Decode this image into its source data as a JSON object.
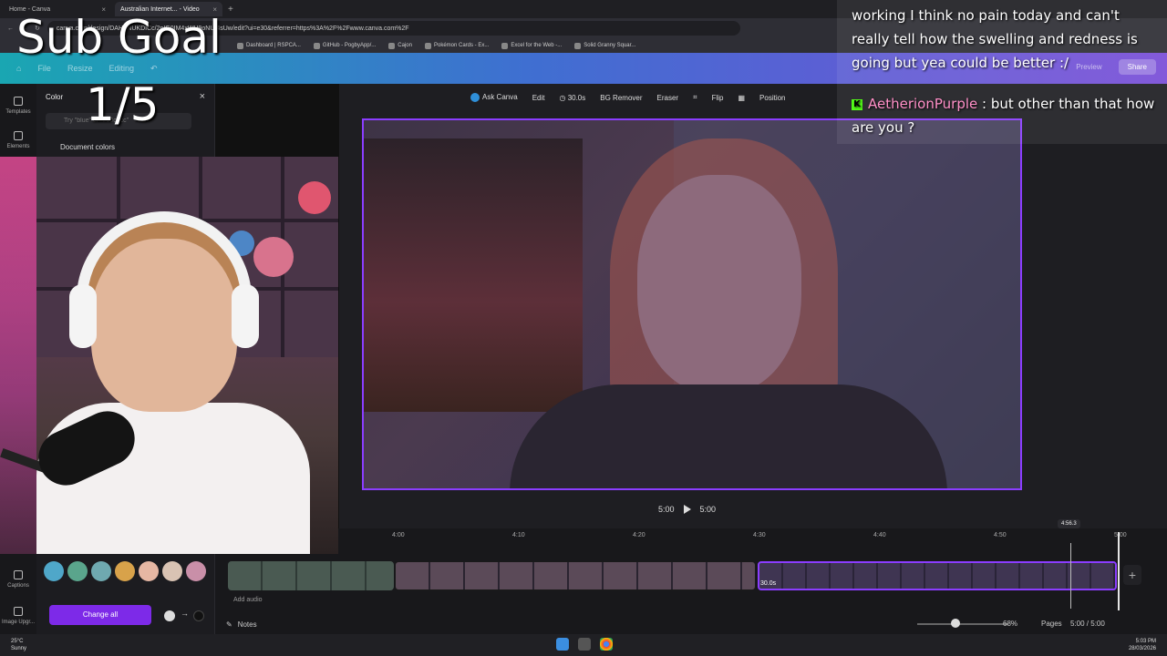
{
  "browser": {
    "tabs": [
      {
        "label": "Home - Canva",
        "active": false
      },
      {
        "label": "Australian Internet... - Video",
        "active": true
      }
    ],
    "url": "canva.com/design/DAHFNUKDICc/2pIG0IM4xWH9oNUI4sUw/edit?ui=e30&referrer=https%3A%2F%2Fwww.canva.com%2F",
    "bookmarks": [
      "Dashboard | RSPCA...",
      "GitHub - PogbyApp/...",
      "Cajon",
      "Pokémon Cards - Ex...",
      "Excel for the Web -...",
      "Solid Granny Squar..."
    ]
  },
  "canva_header": {
    "menu": [
      "File",
      "Resize",
      "Editing"
    ],
    "preview_label": "Preview",
    "share_label": "Share"
  },
  "rail": [
    {
      "label": "Templates"
    },
    {
      "label": "Elements"
    },
    {
      "label": "Captions"
    },
    {
      "label": "Image Upgr..."
    }
  ],
  "color_panel": {
    "title": "Color",
    "search_placeholder": "Try \"blue\" or \"#00c4cc\"",
    "section": "Document colors",
    "swatches": [
      "#4fa7c9",
      "#5aa58c",
      "#6fa9b0",
      "#d8a24a",
      "#e6b7a3",
      "#d9c3b3",
      "#c98fa8"
    ],
    "change_all_label": "Change all"
  },
  "overlay": {
    "goal_label": "Sub Goal",
    "goal_count": "1/5"
  },
  "context_toolbar": {
    "ask": "Ask Canva",
    "edit": "Edit",
    "duration": "30.0s",
    "bg_remover": "BG Remover",
    "eraser": "Eraser",
    "flip": "Flip",
    "position": "Position"
  },
  "chat": {
    "message1": "working I think no pain today and can't really tell how the swelling and redness is going but yea could be better :/",
    "message2_user": "AetherionPurple",
    "message2_text": ": but other than that how are you ?"
  },
  "playback": {
    "current": "5:00",
    "total": "5:00"
  },
  "timeline": {
    "ticks": [
      "4:00",
      "4:10",
      "4:20",
      "4:30",
      "4:40",
      "4:50",
      "5:00"
    ],
    "playhead_time": "4:56.3",
    "clip_label": "30.0s",
    "add_audio": "Add audio"
  },
  "bottombar": {
    "notes": "Notes",
    "zoom": "68%",
    "pages": "Pages",
    "page_count": "5:00 / 5:00"
  },
  "taskbar": {
    "weather_temp": "25°C",
    "weather_desc": "Sunny",
    "time": "5:03 PM",
    "date": "28/03/2026"
  }
}
